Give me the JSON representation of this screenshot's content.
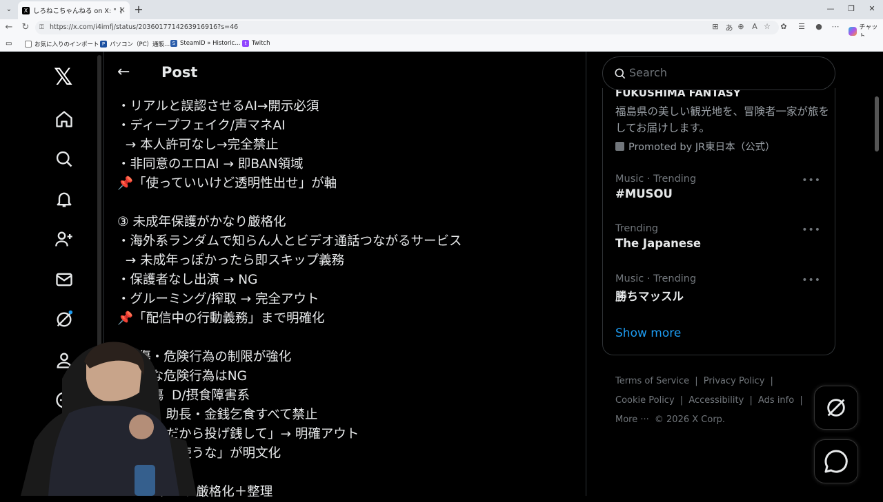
{
  "browser": {
    "tab_title": "しろねこちゃんねる on X: \"【KICK/規約",
    "url": "https://x.com/i4imfj/status/2036017714263916916?s=46",
    "chat_label": "チャット",
    "bookmarks": [
      {
        "label": "お気に入りのインポート"
      },
      {
        "label": "パソコン（PC）通販..."
      },
      {
        "label": "SteamID » Historic..."
      },
      {
        "label": "Twitch"
      }
    ]
  },
  "x": {
    "logo": "𝕏",
    "header_title": "Post",
    "post_lines": [
      "・リアルと誤認させるAI→開示必須",
      "・ディープフェイク/声マネAI",
      "  → 本人許可なし→完全禁止",
      "・非同意のエロAI → 即BAN領域",
      "📌「使っていいけど透明性出せ」が軸",
      "",
      "③ 未成年保護がかなり厳格化",
      "・海外系ランダムで知らん人とビデオ通話つながるサービス",
      "  → 未成年っぽかったら即スキップ義務",
      "・保護者なし出演 → NG",
      "・グルーミング/搾取 → 完全アウト",
      "📌「配信中の行動義務」まで明確化",
      "",
      "  自傷・危険行為の制限が強化",
      "  ・大な危険行為はNG",
      "  ・自傷  D/摂食障害系",
      "            助長・金銭乞食すべて禁止",
      "            だから投げ銭して」→ 明確アウト",
      "            に使うな」が明文化",
      "",
      "          テンツ厳格化＋整理"
    ],
    "search_placeholder": "Search",
    "promo": {
      "title": "FUKUSHIMA FANTASY",
      "description": "福島県の美しい観光地を、冒険者一家が旅をしてお届けします。",
      "promoted_by": "Promoted by JR東日本（公式）"
    },
    "trends": [
      {
        "meta": "Music · Trending",
        "name": "#MUSOU"
      },
      {
        "meta": "Trending",
        "name": "The Japanese"
      },
      {
        "meta": "Music · Trending",
        "name": "勝ちマッスル"
      }
    ],
    "show_more": "Show more",
    "footer": {
      "terms": "Terms of Service",
      "privacy": "Privacy Policy",
      "cookie": "Cookie Policy",
      "accessibility": "Accessibility",
      "ads": "Ads info",
      "more": "More ···",
      "copyright": "© 2026 X Corp."
    }
  },
  "colors": {
    "accent": "#1d9bf0",
    "text": "#e7e9ea",
    "muted": "#71767b",
    "background": "#000000"
  }
}
